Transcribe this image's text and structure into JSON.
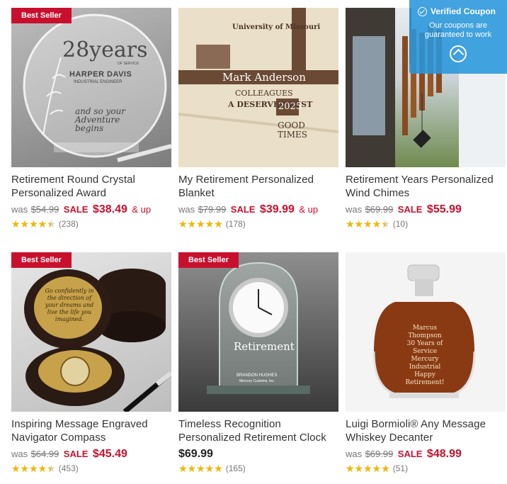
{
  "coupon": {
    "heading": "Verified Coupon",
    "message": "Our coupons are guaranteed to work",
    "icon": "tag-icon"
  },
  "products": [
    {
      "badge": "Best Seller",
      "title": "Retirement Round Crystal Personalized Award",
      "was_label": "was",
      "was_price": "$54.99",
      "sale_label": "SALE",
      "sale_price": "$38.49",
      "and_up": "& up",
      "rating": 4.5,
      "review_count": "(238)",
      "image_text": {
        "big": "28years",
        "small": "OF SERVICE",
        "name": "HARPER DAVIS",
        "role": "INDUSTRIAL ENGINEER",
        "script": "and so your Adventure begins"
      }
    },
    {
      "badge": "",
      "title": "My Retirement Personalized Blanket",
      "was_label": "was",
      "was_price": "$79.99",
      "sale_label": "SALE",
      "sale_price": "$39.99",
      "and_up": "& up",
      "rating": 5,
      "review_count": "(178)",
      "image_text": {
        "name": "Mark Anderson",
        "line1": "University of Missouri",
        "line2": "COLLEAGUES",
        "line3": "A DESERVED REST",
        "year": "2025",
        "line4": "GOOD TIMES"
      }
    },
    {
      "badge": "",
      "title": "Retirement Years Personalized Wind Chimes",
      "was_label": "was",
      "was_price": "$69.99",
      "sale_label": "SALE",
      "sale_price": "$55.99",
      "and_up": "",
      "rating": 4.5,
      "review_count": "(10)"
    },
    {
      "badge": "Best Seller",
      "title": "Inspiring Message Engraved Navigator Compass",
      "was_label": "was",
      "was_price": "$64.99",
      "sale_label": "SALE",
      "sale_price": "$45.49",
      "and_up": "",
      "rating": 4.5,
      "review_count": "(453)",
      "image_text": {
        "message": "Go confidently in the direction of your dreams and live the life you imagined."
      }
    },
    {
      "badge": "Best Seller",
      "title": "Timeless Recognition Personalized Retirement Clock",
      "price": "$69.99",
      "rating": 5,
      "review_count": "(165)",
      "image_text": {
        "heading": "Retirement",
        "name": "BRANDON HUGHES",
        "company": "Mercury Customs, Inc."
      }
    },
    {
      "badge": "",
      "title": "Luigi Bormioli® Any Message Whiskey Decanter",
      "was_label": "was",
      "was_price": "$69.99",
      "sale_label": "SALE",
      "sale_price": "$48.99",
      "and_up": "",
      "rating": 5,
      "review_count": "(51)",
      "image_text": {
        "line1": "Marcus Thompson",
        "line2": "30 Years of Service",
        "line3": "Mercury Industrial",
        "line4": "Happy Retirement!"
      }
    }
  ],
  "colors": {
    "sale_red": "#c8102e",
    "star_gold": "#f0b800",
    "coupon_blue": "#2896dc"
  }
}
